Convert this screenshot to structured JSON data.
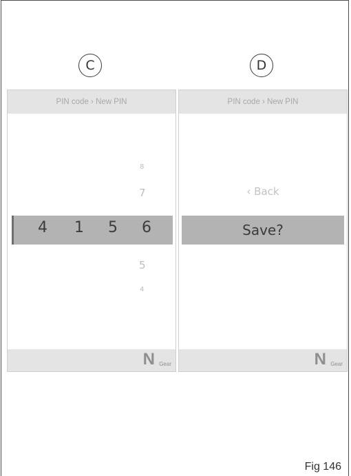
{
  "labels": {
    "c": "C",
    "d": "D"
  },
  "panel_c": {
    "breadcrumb": "PIN code › New PIN",
    "pin_digits": [
      "4",
      "1",
      "5",
      "6"
    ],
    "scroll_above_far": "8",
    "scroll_above": "7",
    "scroll_below": "5",
    "scroll_below_far": "4",
    "gear_letter": "N",
    "gear_label": "Gear"
  },
  "panel_d": {
    "breadcrumb": "PIN code › New PIN",
    "back_label": "‹ Back",
    "save_label": "Save?",
    "gear_letter": "N",
    "gear_label": "Gear"
  },
  "caption": "Fig 146"
}
